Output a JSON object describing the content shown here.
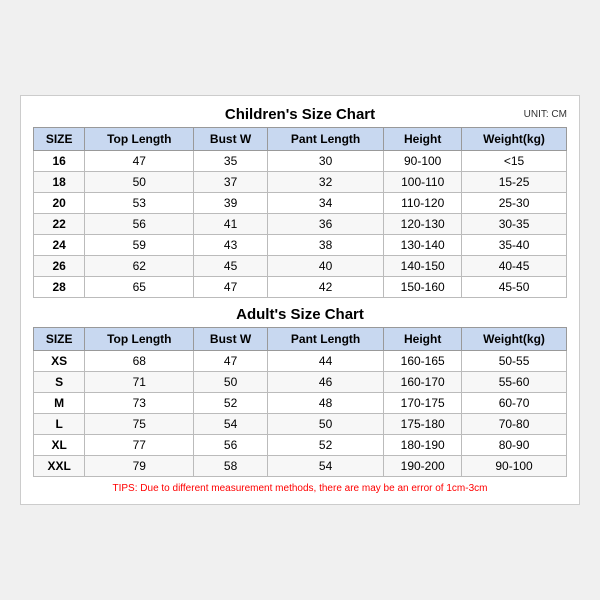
{
  "children_title": "Children's Size Chart",
  "adult_title": "Adult's Size Chart",
  "unit": "UNIT: CM",
  "headers": [
    "SIZE",
    "Top Length",
    "Bust W",
    "Pant Length",
    "Height",
    "Weight(kg)"
  ],
  "children_rows": [
    [
      "16",
      "47",
      "35",
      "30",
      "90-100",
      "<15"
    ],
    [
      "18",
      "50",
      "37",
      "32",
      "100-110",
      "15-25"
    ],
    [
      "20",
      "53",
      "39",
      "34",
      "110-120",
      "25-30"
    ],
    [
      "22",
      "56",
      "41",
      "36",
      "120-130",
      "30-35"
    ],
    [
      "24",
      "59",
      "43",
      "38",
      "130-140",
      "35-40"
    ],
    [
      "26",
      "62",
      "45",
      "40",
      "140-150",
      "40-45"
    ],
    [
      "28",
      "65",
      "47",
      "42",
      "150-160",
      "45-50"
    ]
  ],
  "adult_rows": [
    [
      "XS",
      "68",
      "47",
      "44",
      "160-165",
      "50-55"
    ],
    [
      "S",
      "71",
      "50",
      "46",
      "160-170",
      "55-60"
    ],
    [
      "M",
      "73",
      "52",
      "48",
      "170-175",
      "60-70"
    ],
    [
      "L",
      "75",
      "54",
      "50",
      "175-180",
      "70-80"
    ],
    [
      "XL",
      "77",
      "56",
      "52",
      "180-190",
      "80-90"
    ],
    [
      "XXL",
      "79",
      "58",
      "54",
      "190-200",
      "90-100"
    ]
  ],
  "tips": "TIPS: Due to different measurement methods, there are may be an error of 1cm-3cm"
}
